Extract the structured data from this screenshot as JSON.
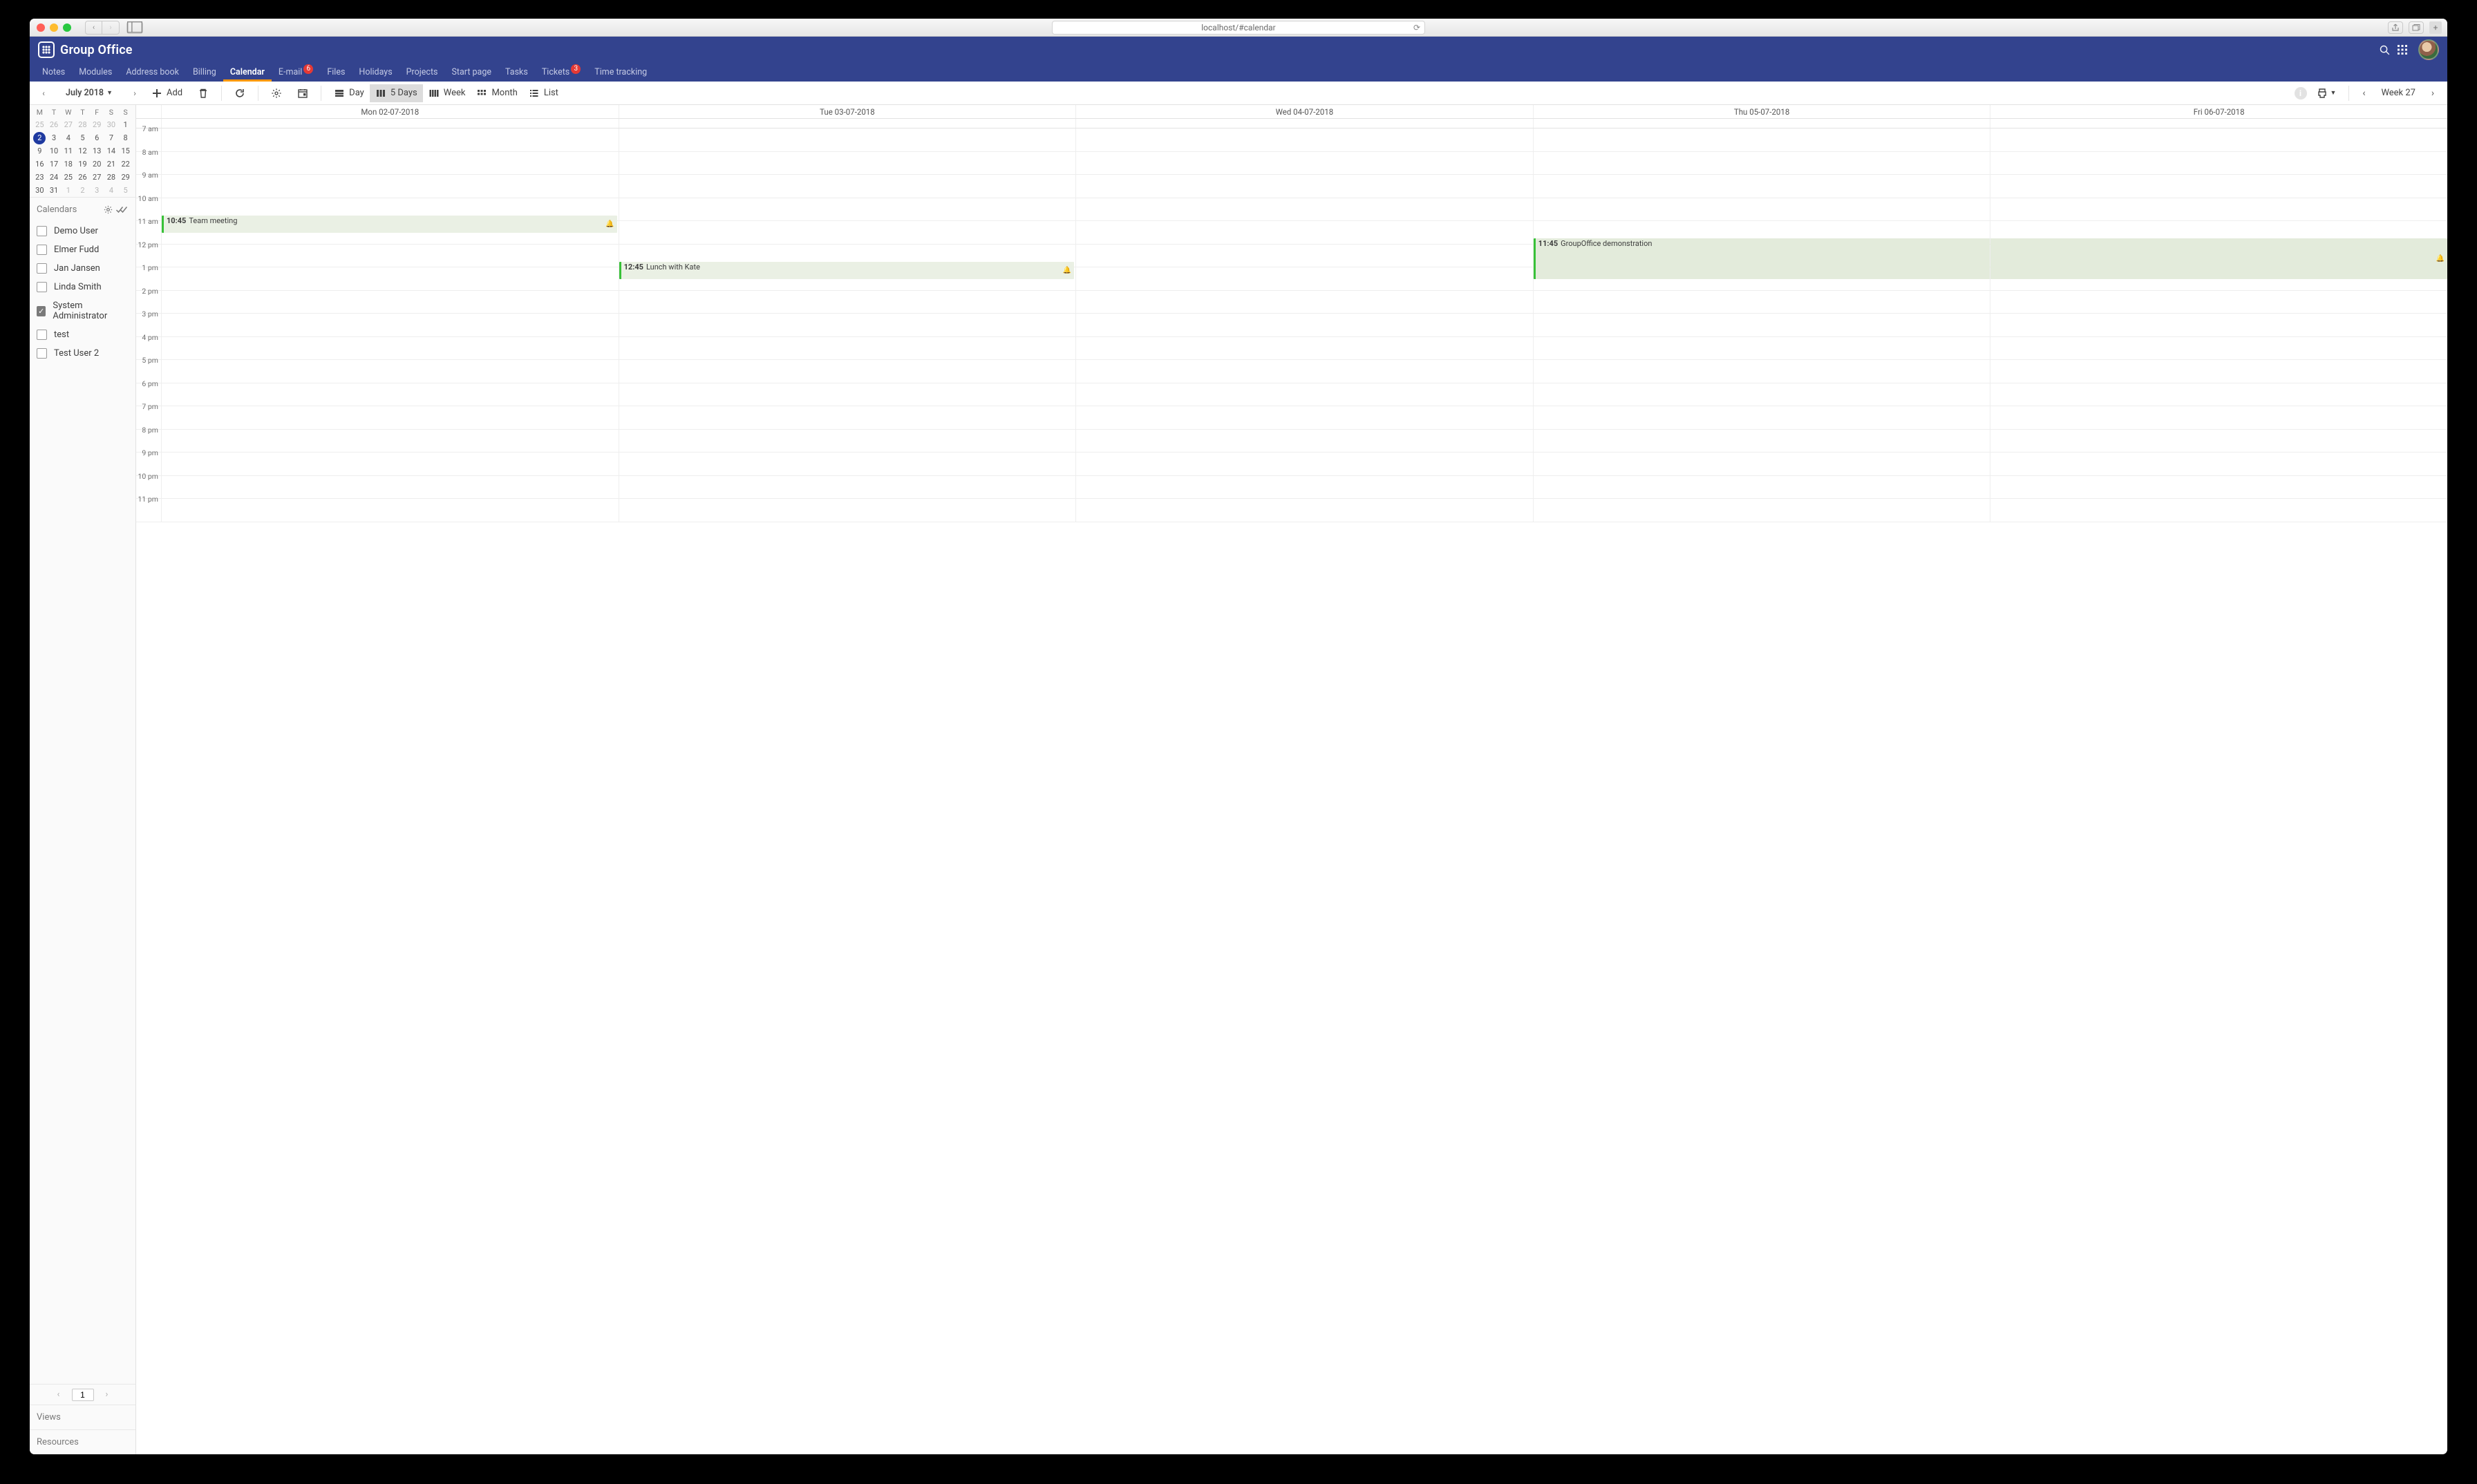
{
  "browser": {
    "url": "localhost/#calendar"
  },
  "app": {
    "title": "Group Office",
    "nav": [
      {
        "label": "Notes",
        "active": false
      },
      {
        "label": "Modules",
        "active": false
      },
      {
        "label": "Address book",
        "active": false
      },
      {
        "label": "Billing",
        "active": false
      },
      {
        "label": "Calendar",
        "active": true
      },
      {
        "label": "E-mail",
        "active": false,
        "badge": "6"
      },
      {
        "label": "Files",
        "active": false
      },
      {
        "label": "Holidays",
        "active": false
      },
      {
        "label": "Projects",
        "active": false
      },
      {
        "label": "Start page",
        "active": false
      },
      {
        "label": "Tasks",
        "active": false
      },
      {
        "label": "Tickets",
        "active": false,
        "badge": "3"
      },
      {
        "label": "Time tracking",
        "active": false
      }
    ]
  },
  "toolbar": {
    "month": "July 2018",
    "add": "Add",
    "views": [
      {
        "key": "day",
        "label": "Day",
        "active": false
      },
      {
        "key": "5days",
        "label": "5 Days",
        "active": true
      },
      {
        "key": "week",
        "label": "Week",
        "active": false
      },
      {
        "key": "month",
        "label": "Month",
        "active": false
      },
      {
        "key": "list",
        "label": "List",
        "active": false
      }
    ],
    "week": "Week 27"
  },
  "miniCal": {
    "dow": [
      "M",
      "T",
      "W",
      "T",
      "F",
      "S",
      "S"
    ],
    "weeks": [
      [
        {
          "d": "25",
          "o": true
        },
        {
          "d": "26",
          "o": true
        },
        {
          "d": "27",
          "o": true
        },
        {
          "d": "28",
          "o": true
        },
        {
          "d": "29",
          "o": true
        },
        {
          "d": "30",
          "o": true
        },
        {
          "d": "1"
        }
      ],
      [
        {
          "d": "2",
          "sel": true
        },
        {
          "d": "3"
        },
        {
          "d": "4"
        },
        {
          "d": "5"
        },
        {
          "d": "6"
        },
        {
          "d": "7"
        },
        {
          "d": "8"
        }
      ],
      [
        {
          "d": "9"
        },
        {
          "d": "10"
        },
        {
          "d": "11"
        },
        {
          "d": "12"
        },
        {
          "d": "13"
        },
        {
          "d": "14"
        },
        {
          "d": "15"
        }
      ],
      [
        {
          "d": "16"
        },
        {
          "d": "17"
        },
        {
          "d": "18"
        },
        {
          "d": "19"
        },
        {
          "d": "20"
        },
        {
          "d": "21"
        },
        {
          "d": "22"
        }
      ],
      [
        {
          "d": "23"
        },
        {
          "d": "24"
        },
        {
          "d": "25"
        },
        {
          "d": "26"
        },
        {
          "d": "27"
        },
        {
          "d": "28"
        },
        {
          "d": "29"
        }
      ],
      [
        {
          "d": "30"
        },
        {
          "d": "31"
        },
        {
          "d": "1",
          "o": true
        },
        {
          "d": "2",
          "o": true
        },
        {
          "d": "3",
          "o": true
        },
        {
          "d": "4",
          "o": true
        },
        {
          "d": "5",
          "o": true
        }
      ]
    ]
  },
  "sidebar": {
    "calendarsTitle": "Calendars",
    "calendars": [
      {
        "name": "Demo User",
        "checked": false
      },
      {
        "name": "Elmer Fudd",
        "checked": false
      },
      {
        "name": "Jan Jansen",
        "checked": false
      },
      {
        "name": "Linda Smith",
        "checked": false
      },
      {
        "name": "System Administrator",
        "checked": true
      },
      {
        "name": "test",
        "checked": false
      },
      {
        "name": "Test User 2",
        "checked": false
      }
    ],
    "page": "1",
    "views": "Views",
    "resources": "Resources"
  },
  "grid": {
    "days": [
      "Mon 02-07-2018",
      "Tue 03-07-2018",
      "Wed 04-07-2018",
      "Thu 05-07-2018",
      "Fri 06-07-2018"
    ],
    "hours": [
      "7 am",
      "8 am",
      "9 am",
      "10 am",
      "11 am",
      "12 pm",
      "1 pm",
      "2 pm",
      "3 pm",
      "4 pm",
      "5 pm",
      "6 pm",
      "7 pm",
      "8 pm",
      "9 pm",
      "10 pm",
      "11 pm"
    ],
    "events": [
      {
        "day": 0,
        "time": "10:45",
        "title": "Team meeting",
        "top": 125.6,
        "height": 25.1,
        "bell": true
      },
      {
        "day": 1,
        "time": "12:45",
        "title": "Lunch with Kate",
        "top": 192.6,
        "height": 25.1,
        "bell": true
      },
      {
        "day": 3,
        "time": "11:45",
        "title": "GroupOffice demonstration",
        "top": 159.1,
        "height": 58.6,
        "bell": true,
        "wide": true
      }
    ]
  }
}
